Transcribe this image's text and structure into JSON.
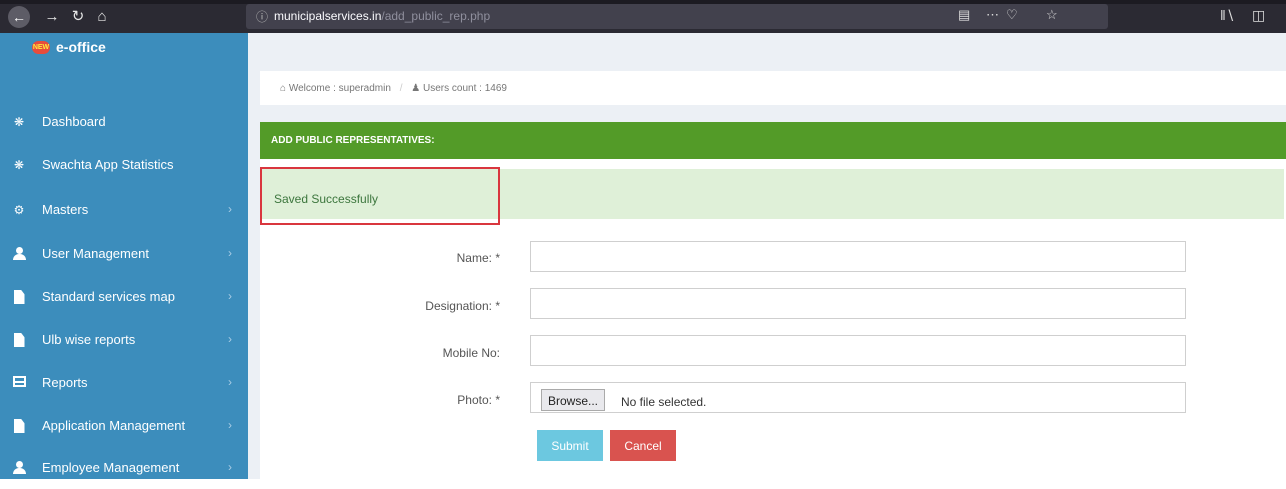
{
  "browser": {
    "url_domain": "municipalservices.in",
    "url_path": "/add_public_rep.php"
  },
  "sidebar": {
    "brand_badge": "NEW",
    "brand": "e-office",
    "items": [
      {
        "label": "Dashboard"
      },
      {
        "label": "Swachta App Statistics"
      },
      {
        "label": "Masters"
      },
      {
        "label": "User Management"
      },
      {
        "label": "Standard services map"
      },
      {
        "label": "Ulb wise reports"
      },
      {
        "label": "Reports"
      },
      {
        "label": "Application Management"
      },
      {
        "label": "Employee Management"
      }
    ]
  },
  "breadcrumb": {
    "welcome": "Welcome : superadmin",
    "users_count": "Users count : 1469"
  },
  "panel": {
    "title": "ADD PUBLIC REPRESENTATIVES:"
  },
  "alert": {
    "message": "Saved Successfully"
  },
  "form": {
    "name_label": "Name: *",
    "designation_label": "Designation: *",
    "mobile_label": "Mobile No:",
    "photo_label": "Photo: *",
    "browse_label": "Browse...",
    "no_file_text": "No file selected.",
    "submit_label": "Submit",
    "cancel_label": "Cancel"
  },
  "colors": {
    "sidebar": "#3c8dbc",
    "panel_header": "#539b28",
    "alert_bg": "#dff0d8",
    "submit": "#6cc8e0",
    "cancel": "#d9534f",
    "highlight": "#d9363e"
  }
}
